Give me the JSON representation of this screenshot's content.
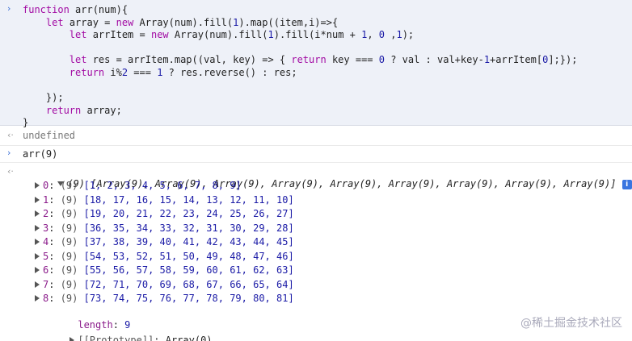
{
  "input_block": {
    "prompt_glyph": "›",
    "lines": [
      {
        "parts": [
          {
            "c": "kw",
            "t": "function"
          },
          {
            "c": "plain",
            "t": " arr(num){"
          }
        ]
      },
      {
        "parts": [
          {
            "c": "plain",
            "t": "    "
          },
          {
            "c": "kw",
            "t": "let"
          },
          {
            "c": "plain",
            "t": " array = "
          },
          {
            "c": "kw",
            "t": "new"
          },
          {
            "c": "plain",
            "t": " Array(num).fill("
          },
          {
            "c": "num",
            "t": "1"
          },
          {
            "c": "plain",
            "t": ").map((item,i)=>{"
          }
        ]
      },
      {
        "parts": [
          {
            "c": "plain",
            "t": "        "
          },
          {
            "c": "kw",
            "t": "let"
          },
          {
            "c": "plain",
            "t": " arrItem = "
          },
          {
            "c": "kw",
            "t": "new"
          },
          {
            "c": "plain",
            "t": " Array(num).fill("
          },
          {
            "c": "num",
            "t": "1"
          },
          {
            "c": "plain",
            "t": ").fill(i*num + "
          },
          {
            "c": "num",
            "t": "1"
          },
          {
            "c": "plain",
            "t": ", "
          },
          {
            "c": "num",
            "t": "0"
          },
          {
            "c": "plain",
            "t": " ,"
          },
          {
            "c": "num",
            "t": "1"
          },
          {
            "c": "plain",
            "t": ");"
          }
        ]
      },
      {
        "parts": [
          {
            "c": "plain",
            "t": ""
          }
        ]
      },
      {
        "parts": [
          {
            "c": "plain",
            "t": "        "
          },
          {
            "c": "kw",
            "t": "let"
          },
          {
            "c": "plain",
            "t": " res = arrItem.map((val, key) => { "
          },
          {
            "c": "kw",
            "t": "return"
          },
          {
            "c": "plain",
            "t": " key === "
          },
          {
            "c": "num",
            "t": "0"
          },
          {
            "c": "plain",
            "t": " ? val : val+key-"
          },
          {
            "c": "num",
            "t": "1"
          },
          {
            "c": "plain",
            "t": "+arrItem["
          },
          {
            "c": "num",
            "t": "0"
          },
          {
            "c": "plain",
            "t": "];});"
          }
        ]
      },
      {
        "parts": [
          {
            "c": "plain",
            "t": "        "
          },
          {
            "c": "kw",
            "t": "return"
          },
          {
            "c": "plain",
            "t": " i%"
          },
          {
            "c": "num",
            "t": "2"
          },
          {
            "c": "plain",
            "t": " === "
          },
          {
            "c": "num",
            "t": "1"
          },
          {
            "c": "plain",
            "t": " ? res.reverse() : res;"
          }
        ]
      },
      {
        "parts": [
          {
            "c": "plain",
            "t": ""
          }
        ]
      },
      {
        "parts": [
          {
            "c": "plain",
            "t": "    });"
          }
        ]
      },
      {
        "parts": [
          {
            "c": "plain",
            "t": "    "
          },
          {
            "c": "kw",
            "t": "return"
          },
          {
            "c": "plain",
            "t": " array;"
          }
        ]
      },
      {
        "parts": [
          {
            "c": "plain",
            "t": "}"
          }
        ]
      }
    ]
  },
  "undefined_result": {
    "glyph": "‹·",
    "text": "undefined"
  },
  "call": {
    "prompt_glyph": "›",
    "text": "arr(9)"
  },
  "output": {
    "return_glyph": "‹·",
    "summary": "(9) [Array(9), Array(9), Array(9), Array(9), Array(9), Array(9), Array(9), Array(9), Array(9)]",
    "info_badge": "i",
    "rows": [
      {
        "key": "0",
        "count": "(9)",
        "values": "[1, 2, 3, 4, 5, 6, 7, 8, 9]"
      },
      {
        "key": "1",
        "count": "(9)",
        "values": "[18, 17, 16, 15, 14, 13, 12, 11, 10]"
      },
      {
        "key": "2",
        "count": "(9)",
        "values": "[19, 20, 21, 22, 23, 24, 25, 26, 27]"
      },
      {
        "key": "3",
        "count": "(9)",
        "values": "[36, 35, 34, 33, 32, 31, 30, 29, 28]"
      },
      {
        "key": "4",
        "count": "(9)",
        "values": "[37, 38, 39, 40, 41, 42, 43, 44, 45]"
      },
      {
        "key": "5",
        "count": "(9)",
        "values": "[54, 53, 52, 51, 50, 49, 48, 47, 46]"
      },
      {
        "key": "6",
        "count": "(9)",
        "values": "[55, 56, 57, 58, 59, 60, 61, 62, 63]"
      },
      {
        "key": "7",
        "count": "(9)",
        "values": "[72, 71, 70, 69, 68, 67, 66, 65, 64]"
      },
      {
        "key": "8",
        "count": "(9)",
        "values": "[73, 74, 75, 76, 77, 78, 79, 80, 81]"
      }
    ],
    "length_key": "length",
    "length_value": "9",
    "prototype_key": "[[Prototype]]",
    "prototype_value": "Array(0)"
  },
  "watermark": "@稀土掘金技术社区"
}
